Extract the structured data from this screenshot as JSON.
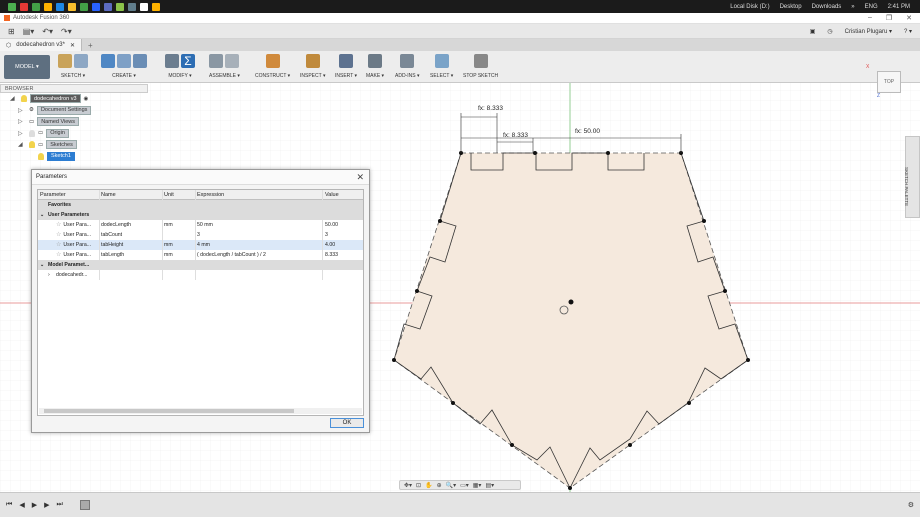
{
  "os_taskbar": {
    "items": [
      "Local Disk (D:)",
      "Desktop",
      "Downloads"
    ],
    "chevron": "»",
    "language": "ENG",
    "time": "2:41 PM",
    "icon_colors": [
      "#4caf50",
      "#e53935",
      "#43a047",
      "#ffb300",
      "#1e88e5",
      "#fbc02d",
      "#43a047",
      "#2962ff",
      "#5c6bc0",
      "#8bc34a",
      "#607d8b",
      "#ffffff",
      "#ffb300"
    ]
  },
  "app": {
    "title": "Autodesk Fusion 360",
    "window_controls": [
      "–",
      "❐",
      "✕"
    ]
  },
  "qat": {
    "grid_label": "⊞",
    "file_label": "▤▾",
    "undo": "↶▾",
    "redo": "↷▾",
    "user": "Cristian Plugaru ▾",
    "help": "? ▾"
  },
  "document": {
    "tab_label": "dodecahedron v3*",
    "close": "✕",
    "new_tab": "+"
  },
  "toolbar": {
    "mode": "MODEL ▾",
    "groups": [
      "SKETCH ▾",
      "CREATE ▾",
      "MODIFY ▾",
      "ASSEMBLE ▾",
      "CONSTRUCT ▾",
      "INSPECT ▾",
      "INSERT ▾",
      "MAKE ▾",
      "ADD-INS ▾",
      "SELECT ▾",
      "STOP SKETCH"
    ],
    "colors": {
      "sketch": "#c9a35a",
      "create": "#4f87c4",
      "modify": "#6b7d8f",
      "modify_selected": "#2d6db3",
      "assemble": "#8a97a3",
      "construct": "#d08a3c",
      "inspect": "#c08a3c",
      "insert": "#5d7290",
      "make": "#6c7a87",
      "addins": "#7a8896",
      "select": "#7aa3c8",
      "stop": "#888888"
    }
  },
  "browser": {
    "header": "BROWSER",
    "items": [
      {
        "label": "dodecahedron v3",
        "expand": "◢"
      },
      {
        "label": "Document Settings",
        "expand": "▷"
      },
      {
        "label": "Named Views",
        "expand": "▷"
      },
      {
        "label": "Origin",
        "expand": "▷"
      },
      {
        "label": "Sketches",
        "expand": "◢"
      },
      {
        "label": "Sketch1",
        "expand": ""
      }
    ]
  },
  "viewcube": {
    "label": "TOP",
    "axis_x": "X",
    "axis_z": "Z"
  },
  "sketch_palette": {
    "label": "SKETCH PALETTE"
  },
  "dimensions": {
    "d1": "fx: 8.333",
    "d2": "fx: 8.333",
    "d3": "fx: 50.00"
  },
  "parameters_dialog": {
    "title": "Parameters",
    "close": "✕",
    "columns": [
      "Parameter",
      "Name",
      "Unit",
      "Expression",
      "Value"
    ],
    "group_favorites": "Favorites",
    "group_user": "User Parameters",
    "group_model": "Model Paramet...",
    "model_child": "dodecahedr...",
    "expander_open": "⌄",
    "expander_closed": "›",
    "star": "☆",
    "rows": [
      {
        "parameter": "User Para...",
        "name": "dodecLength",
        "unit": "mm",
        "expression": "50 mm",
        "value": "50.00"
      },
      {
        "parameter": "User Para...",
        "name": "tabCount",
        "unit": "",
        "expression": "3",
        "value": "3"
      },
      {
        "parameter": "User Para...",
        "name": "tabHeight",
        "unit": "mm",
        "expression": "4 mm",
        "value": "4.00"
      },
      {
        "parameter": "User Para...",
        "name": "tabLength",
        "unit": "mm",
        "expression": "( dodecLength / tabCount ) / 2",
        "value": "8.333"
      }
    ],
    "ok_label": "OK"
  },
  "timeline": {
    "controls": [
      "⏮",
      "◀",
      "▶",
      "▶",
      "⏭"
    ],
    "settings": "⚙"
  },
  "navbar": {
    "icons": [
      "✥▾",
      "⊡",
      "✋",
      "⊕",
      "🔍▾",
      "▭▾",
      "▦▾",
      "▤▾"
    ]
  }
}
